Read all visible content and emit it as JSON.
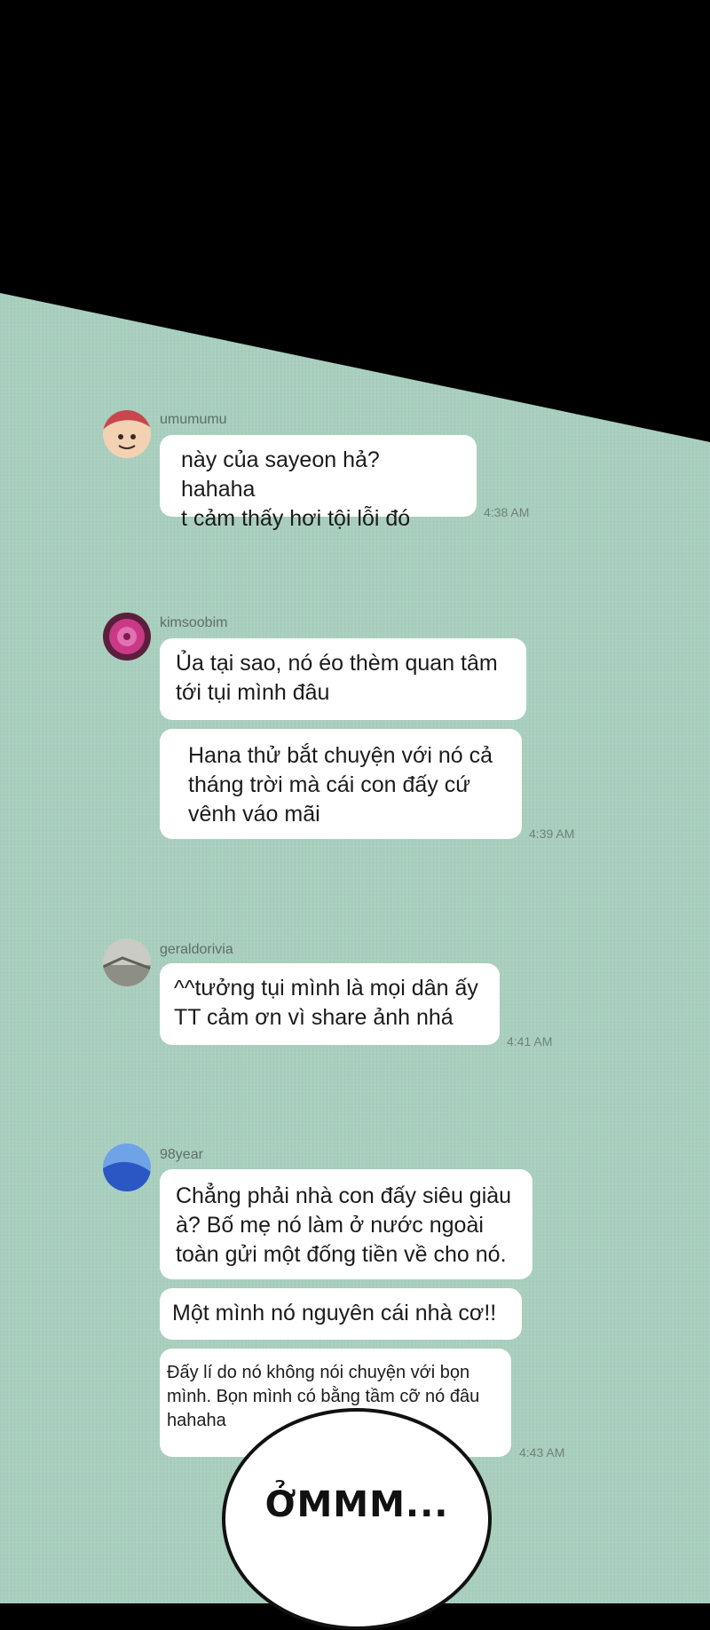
{
  "messages": [
    {
      "user": "umumumu",
      "bubbles": [
        "này của sayeon hả? hahaha\nt cảm thấy hơi tội lỗi đó"
      ],
      "time": "4:38 AM"
    },
    {
      "user": "kimsoobim",
      "bubbles": [
        "Ủa tại sao, nó éo thèm quan tâm\ntới tụi mình đâu",
        "Hana thử bắt chuyện với nó cả\ntháng trời mà cái con đấy cứ\nvênh váo mãi"
      ],
      "time": "4:39 AM"
    },
    {
      "user": "geraldorivia",
      "bubbles": [
        "^^tưởng tụi mình là mọi dân ấy\nTT cảm ơn vì share ảnh nhá"
      ],
      "time": "4:41 AM"
    },
    {
      "user": "98year",
      "bubbles": [
        "Chẳng phải nhà con đấy siêu giàu\nà? Bố mẹ nó làm ở nước ngoài\ntoàn gửi một đống tiền về cho nó.",
        "Một mình nó nguyên cái nhà cơ!!",
        "Đấy lí do nó không nói chuyện với bọn\nmình. Bọn mình có bằng tầm cỡ nó đâu\nhahaha"
      ],
      "time": "4:43 AM"
    }
  ],
  "speech_bubble": {
    "text": "ỞMMM..."
  },
  "colors": {
    "background_top": "#000000",
    "background_chat": "#a9cfbf",
    "bubble": "#ffffff"
  },
  "avatars": [
    "avatar-red-hair-boy",
    "avatar-pink-flower",
    "avatar-landscape",
    "avatar-blue-sky"
  ]
}
